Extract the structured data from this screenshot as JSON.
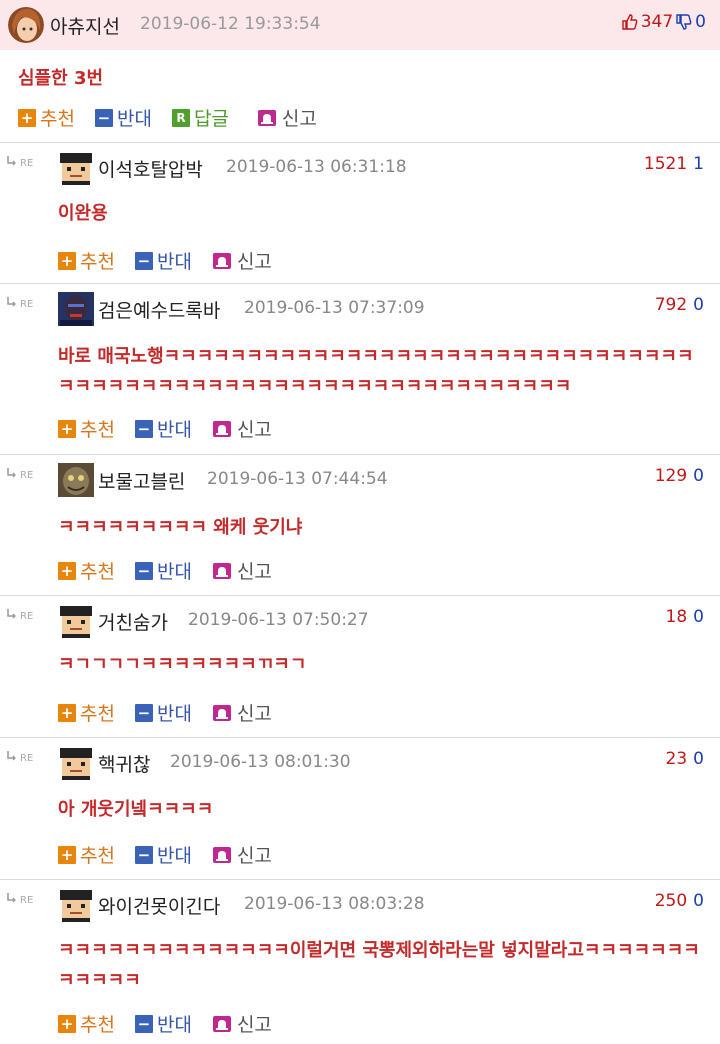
{
  "post": {
    "author": "아츄지선",
    "timestamp": "2019-06-12 19:33:54",
    "upvotes": "347",
    "downvotes": "0",
    "body": "심플한 3번",
    "actions": {
      "recommend": "추천",
      "oppose": "반대",
      "reply_badge": "R",
      "reply": "답글",
      "report": "신고"
    }
  },
  "comment_actions": {
    "recommend": "추천",
    "oppose": "반대",
    "report": "신고"
  },
  "comments": [
    {
      "author": "이석호탈압박",
      "timestamp": "2019-06-13 06:31:18",
      "upvotes": "1521",
      "downvotes": "1",
      "text": "이완용"
    },
    {
      "author": "검은예수드록바",
      "timestamp": "2019-06-13 07:37:09",
      "upvotes": "792",
      "downvotes": "0",
      "text": "바로 매국노행ㅋㅋㅋㅋㅋㅋㅋㅋㅋㅋㅋㅋㅋㅋㅋㅋㅋㅋㅋㅋㅋㅋㅋㅋㅋㅋㅋㅋㅋㅋㅋㅋㅋㅋㅋㅋㅋㅋㅋㅋㅋㅋㅋㅋㅋㅋㅋㅋㅋㅋㅋㅋㅋㅋㅋㅋㅋㅋㅋㅋㅋㅋㅋ"
    },
    {
      "author": "보물고블린",
      "timestamp": "2019-06-13 07:44:54",
      "upvotes": "129",
      "downvotes": "0",
      "text": "ㅋㅋㅋㅋㅋㅋㅋㅋㅋ 왜케 웃기냐"
    },
    {
      "author": "거친숨가",
      "timestamp": "2019-06-13 07:50:27",
      "upvotes": "18",
      "downvotes": "0",
      "text": "ㅋㄱㄱㄱㄱㅋㅋㅋㅋㅋㅋㅋㄲㅋㄱ"
    },
    {
      "author": "핵귀찮",
      "timestamp": "2019-06-13 08:01:30",
      "upvotes": "23",
      "downvotes": "0",
      "text": "아 개웃기넼ㅋㅋㅋㅋ"
    },
    {
      "author": "와이건못이긴다",
      "timestamp": "2019-06-13 08:03:28",
      "upvotes": "250",
      "downvotes": "0",
      "text": "ㅋㅋㅋㅋㅋㅋㅋㅋㅋㅋㅋㅋㅋㅋ이럴거면 국뽕제외하라는말 넣지말라고ㅋㅋㅋㅋㅋㅋㅋㅋㅋㅋㅋㅋ"
    }
  ],
  "colors": {
    "header_bg": "#fce8ea",
    "comment_text": "#c42a2a",
    "upvote": "#c01818",
    "downvote": "#1a3fb0",
    "recommend": "#e8860c",
    "oppose": "#3a63b8"
  },
  "icons": {
    "re": "reply-arrow-icon",
    "thumb_up": "thumb-up-icon",
    "thumb_down": "thumb-down-icon",
    "report": "bell-icon"
  }
}
